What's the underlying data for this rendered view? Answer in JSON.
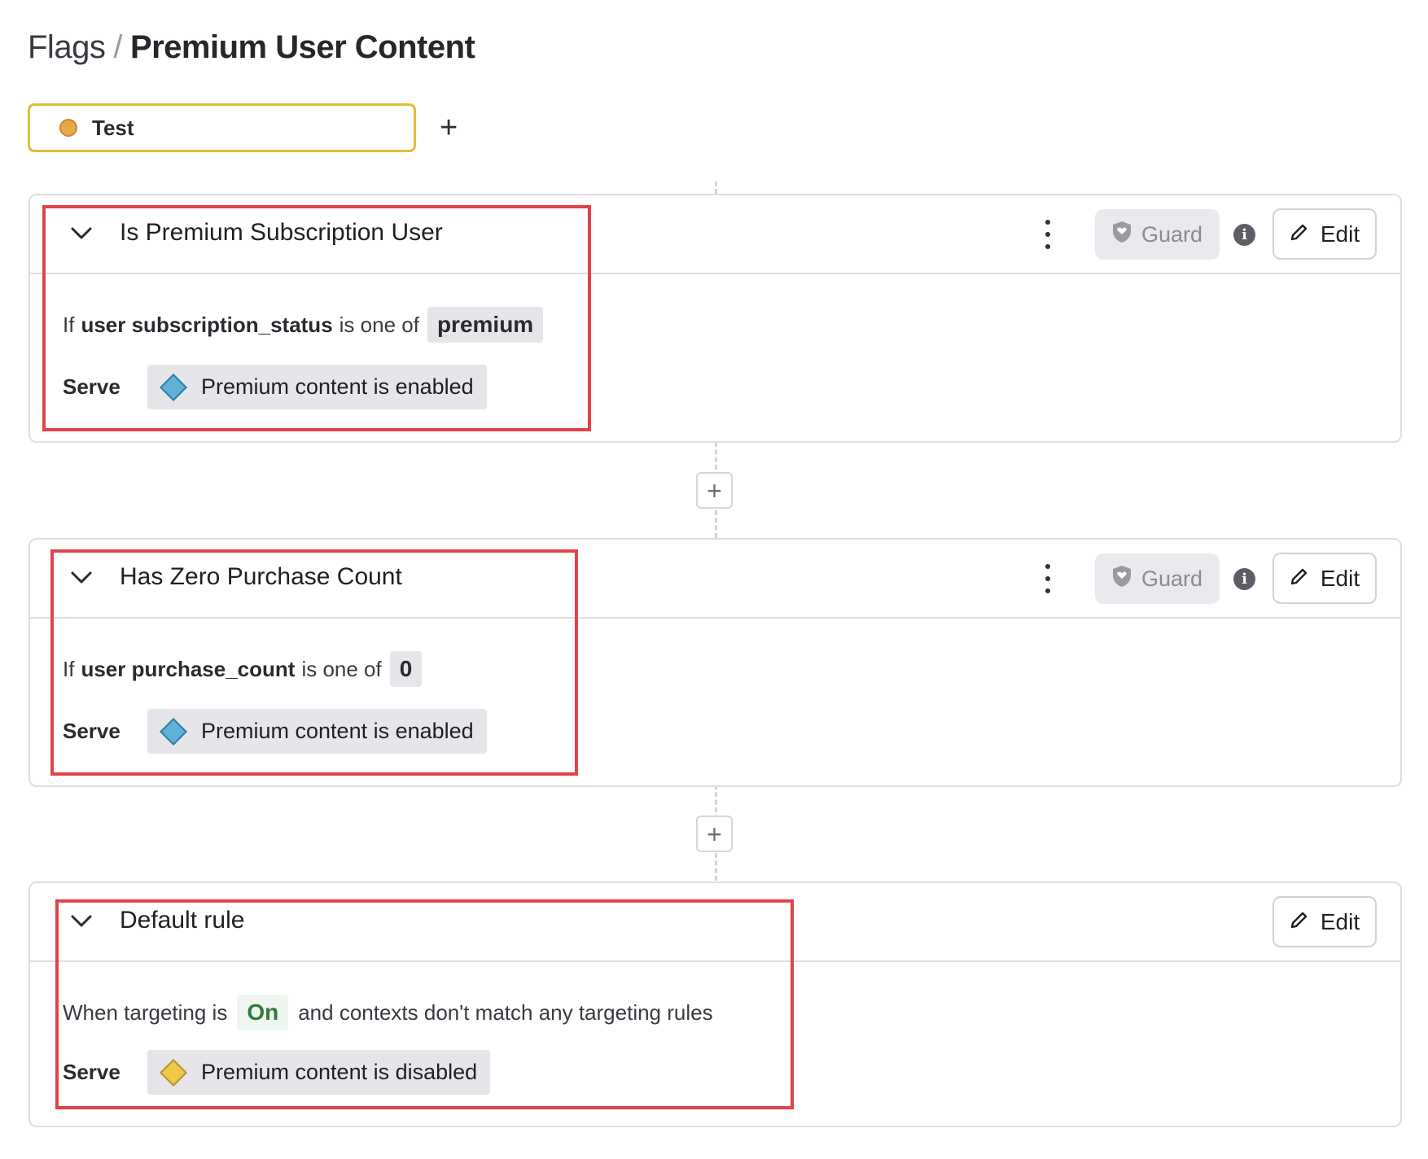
{
  "breadcrumb": {
    "root": "Flags",
    "separator": "/",
    "current": "Premium User Content"
  },
  "environment": {
    "label": "Test",
    "color": "#e9a748",
    "add_label": "+"
  },
  "buttons": {
    "guard_label": "Guard",
    "edit_label": "Edit",
    "info_glyph": "i",
    "add_rule_glyph": "+"
  },
  "rules": [
    {
      "title": "Is Premium Subscription User",
      "condition": {
        "prefix": "If",
        "attribute": "user subscription_status",
        "operator": "is one of",
        "value": "premium"
      },
      "serve_label": "Serve",
      "variation": {
        "label": "Premium content is enabled",
        "color": "#5fb2d6"
      }
    },
    {
      "title": "Has Zero Purchase Count",
      "condition": {
        "prefix": "If",
        "attribute": "user purchase_count",
        "operator": "is one of",
        "value": "0"
      },
      "serve_label": "Serve",
      "variation": {
        "label": "Premium content is enabled",
        "color": "#5fb2d6"
      }
    }
  ],
  "default_rule": {
    "title": "Default rule",
    "text_before": "When targeting is",
    "state": "On",
    "text_after": "and contexts don't match any targeting rules",
    "serve_label": "Serve",
    "variation": {
      "label": "Premium content is disabled",
      "color": "#f0c94c"
    }
  },
  "colors": {
    "highlight": "#e0434a",
    "environment_border": "#e6bb3a"
  }
}
